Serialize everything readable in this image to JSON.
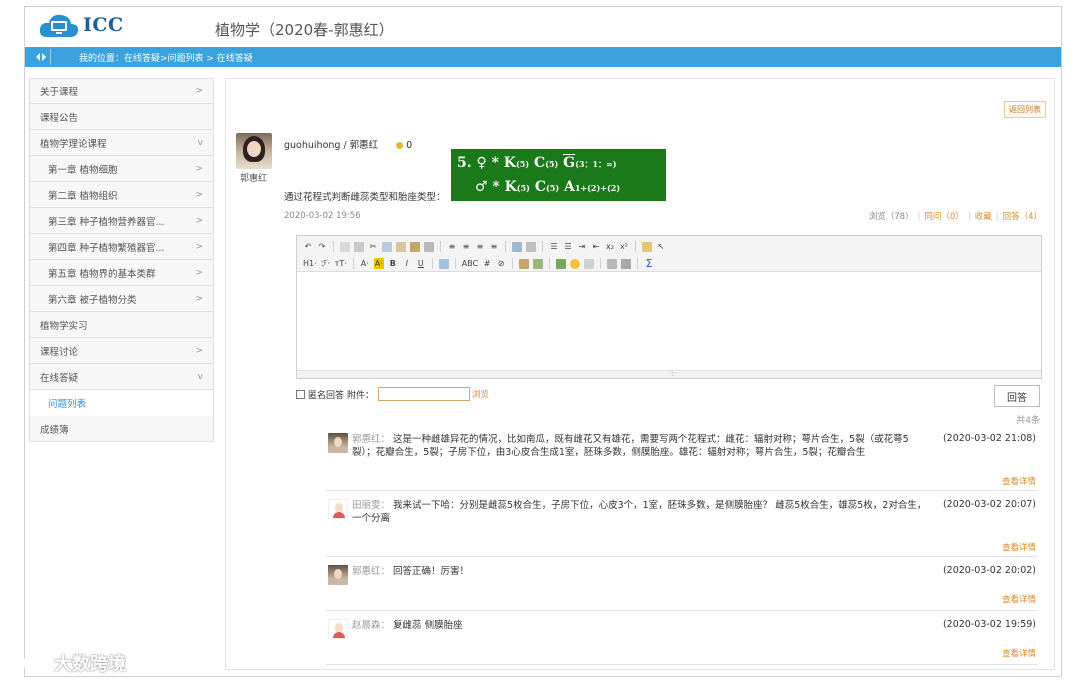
{
  "header": {
    "logo_text": "ICC",
    "course_title": "植物学（2020春-郭惠红）"
  },
  "bluebar": {
    "breadcrumb": "我的位置：在线答疑>问题列表 > 在线答疑"
  },
  "sidebar": {
    "items": [
      {
        "label": "关于课程",
        "arrow": ">"
      },
      {
        "label": "课程公告",
        "arrow": ""
      },
      {
        "label": "植物学理论课程",
        "arrow": "v"
      },
      {
        "label": "第一章 植物细胞",
        "arrow": ">"
      },
      {
        "label": "第二章 植物组织",
        "arrow": ">"
      },
      {
        "label": "第三章 种子植物营养器官...",
        "arrow": ">"
      },
      {
        "label": "第四章 种子植物繁殖器官...",
        "arrow": ">"
      },
      {
        "label": "第五章 植物界的基本类群",
        "arrow": ">"
      },
      {
        "label": "第六章 被子植物分类",
        "arrow": ">"
      },
      {
        "label": "植物学实习",
        "arrow": ""
      },
      {
        "label": "课程讨论",
        "arrow": ">"
      },
      {
        "label": "在线答疑",
        "arrow": "v"
      },
      {
        "label": "问题列表",
        "arrow": ""
      },
      {
        "label": "成绩簿",
        "arrow": ""
      }
    ]
  },
  "question": {
    "back_label": "返回列表",
    "asker_handle": "guohuihong / 郭惠红",
    "asker_name": "郭惠红",
    "coins": "0",
    "text": "通过花程式判断雌蕊类型和胎座类型：",
    "date": "2020-03-02 19:56",
    "stats": {
      "views": "浏览（78）",
      "same_question": "同问（0）",
      "favorite": "收藏",
      "answers": "回答（4）"
    },
    "formula": {
      "line1": "5. ♀ * K",
      "line1_k": "(5)",
      "line1_c": "C",
      "line1_c_sub": "(5)",
      "line1_g": "G",
      "line1_g_sub": "(3：1：∞)",
      "line2": "♂ * K",
      "line2_k": "(5)",
      "line2_c": "C",
      "line2_c_sub": "(5)",
      "line2_a": "A",
      "line2_a_sub": "1+(2)+(2)"
    }
  },
  "editor": {
    "toolbar_row2": [
      "H1·",
      "ℱ·",
      "тT·",
      "A·",
      "A·",
      "B",
      "I",
      "U"
    ],
    "foot_handle": "·:·"
  },
  "answer_form": {
    "anonymous_label": "匿名回答",
    "attachment_label": "附件：",
    "attachment_value": "",
    "browse_label": "浏览",
    "submit_label": "回答",
    "total": "共4条"
  },
  "answers": [
    {
      "name": "郭惠红：",
      "text": "这是一种雌雄异花的情况，比如南瓜，既有雌花又有雄花，需要写两个花程式：雌花：辐射对称；萼片合生，5裂（或花萼5裂）；花瓣合生，5裂；子房下位，由3心皮合生成1室，胚珠多数，侧膜胎座。雄花：辐射对称；萼片合生，5裂；花瓣合生",
      "date": "(2020-03-02 21:08)",
      "detail": "查看详情",
      "avatar": "photo"
    },
    {
      "name": "田丽雯：",
      "text": "我来试一下哈：分别是雌蕊5枚合生，子房下位，心皮3个，1室，胚珠多数，是侧膜胎座？ 雌蕊5枚合生，雄蕊5枚，2对合生，一个分离",
      "date": "(2020-03-02 20:07)",
      "detail": "查看详情",
      "avatar": "plain"
    },
    {
      "name": "郭惠红：",
      "text": "回答正确！厉害！",
      "date": "(2020-03-02 20:02)",
      "detail": "查看详情",
      "avatar": "photo"
    },
    {
      "name": "赵晨森：",
      "text": "复雌蕊 侧膜胎座",
      "date": "(2020-03-02 19:59)",
      "detail": "查看详情",
      "avatar": "plain"
    }
  ],
  "watermark": {
    "text": "大数跨境"
  },
  "colors": {
    "accent_blue": "#3aa2dc",
    "link_orange": "#d98a2a",
    "formula_green": "#1a7a1a"
  }
}
